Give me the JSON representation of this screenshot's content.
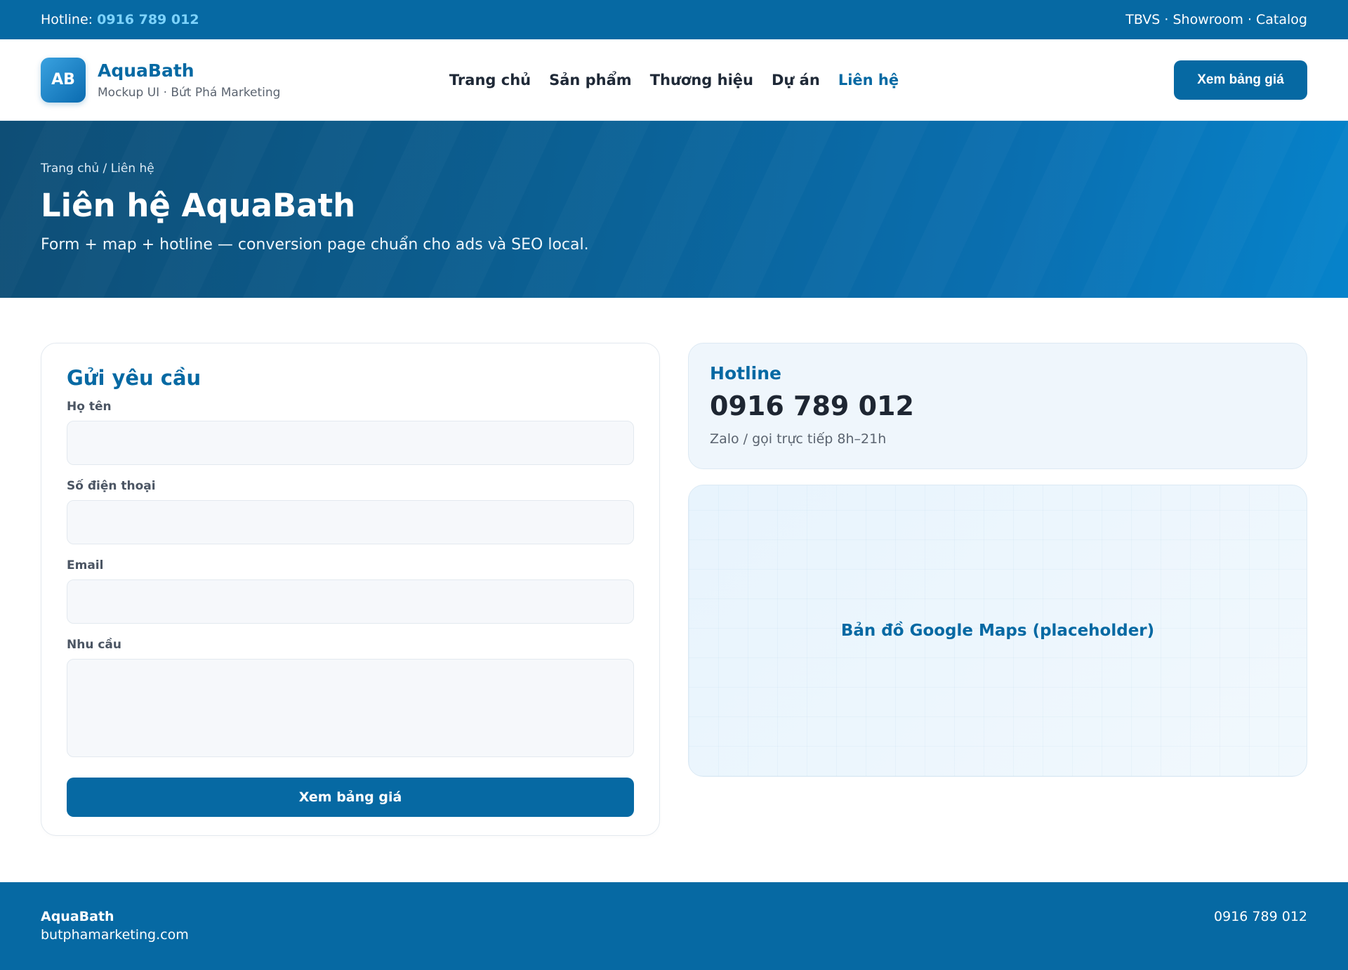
{
  "topbar": {
    "hotline_label": "Hotline:",
    "hotline_number": "0916 789 012",
    "links": "TBVS · Showroom · Catalog"
  },
  "header": {
    "logo_text": "AB",
    "brand_name": "AquaBath",
    "brand_sub": "Mockup UI · Bứt Phá Marketing",
    "nav": [
      {
        "label": "Trang chủ"
      },
      {
        "label": "Sản phẩm"
      },
      {
        "label": "Thương hiệu"
      },
      {
        "label": "Dự án"
      },
      {
        "label": "Liên hệ"
      }
    ],
    "cta_label": "Xem bảng giá"
  },
  "hero": {
    "breadcrumb": "Trang chủ / Liên hệ",
    "title": "Liên hệ AquaBath",
    "subtitle": "Form + map + hotline — conversion page chuẩn cho ads và SEO local."
  },
  "form": {
    "title": "Gửi yêu cầu",
    "name_label": "Họ tên",
    "name_value": "",
    "phone_label": "Số điện thoại",
    "phone_value": "",
    "email_label": "Email",
    "email_value": "",
    "need_label": "Nhu cầu",
    "need_value": "",
    "submit_label": "Xem bảng giá"
  },
  "hotline_card": {
    "label": "Hotline",
    "number": "0916 789 012",
    "note": "Zalo / gọi trực tiếp 8h–21h"
  },
  "map": {
    "placeholder": "Bản đồ Google Maps (placeholder)"
  },
  "footer": {
    "brand": "AquaBath",
    "site": "butphamarketing.com",
    "phone": "0916 789 012"
  },
  "colors": {
    "primary": "#0669a3",
    "accent_light": "#7dd3fc",
    "card_bg": "#eff6fc"
  }
}
